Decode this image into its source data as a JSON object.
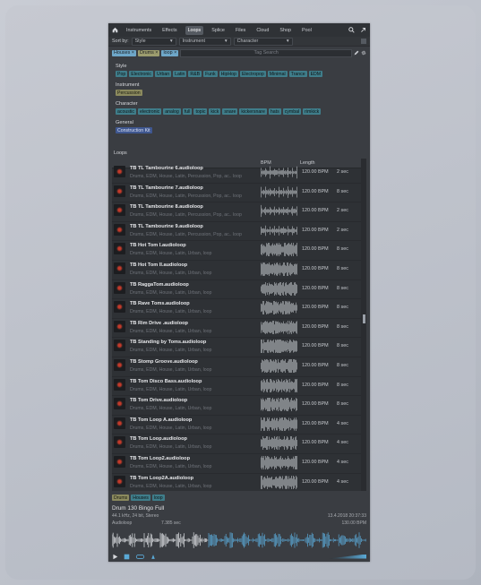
{
  "nav": {
    "tabs": [
      "Instruments",
      "Effects",
      "Loops",
      "Splice",
      "Files",
      "Cloud",
      "Shop",
      "Pool"
    ],
    "active": "Loops"
  },
  "sortbar": {
    "sort_label": "Sort by:",
    "style": "Style",
    "instrument": "Instrument",
    "character": "Character"
  },
  "filters": {
    "chips": [
      "Houses",
      "Drums",
      "loop"
    ],
    "search_placeholder": "Tag Search"
  },
  "sections": {
    "style": {
      "title": "Style",
      "tags": [
        "Pop",
        "Electronic",
        "Urban",
        "Latin",
        "R&B",
        "Funk",
        "HipHop",
        "Electropop",
        "Minimal",
        "Trance",
        "EDM"
      ]
    },
    "instrument": {
      "title": "Instrument",
      "tags": [
        "Percussion"
      ]
    },
    "character": {
      "title": "Character",
      "tags": [
        "acoustic",
        "electronic",
        "analog",
        "full",
        "topic",
        "kick",
        "snare",
        "kickersnare",
        "hats",
        "cymbal",
        "rimkick"
      ]
    },
    "general": {
      "title": "General",
      "tags": [
        "Construction Kit"
      ]
    }
  },
  "loops_label": "Loops",
  "columns": {
    "bpm": "BPM",
    "length": "Length"
  },
  "rows": [
    {
      "title": "TB TL Tambourine  6.audioloop",
      "tags": "Drums, EDM, House, Latin, Percussion, Pop, ac.. loop",
      "bpm": "120.00 BPM",
      "len": "2 sec"
    },
    {
      "title": "TB TL Tambourine  7.audioloop",
      "tags": "Drums, EDM, House, Latin, Percussion, Pop, ac.. loop",
      "bpm": "120.00 BPM",
      "len": "8 sec"
    },
    {
      "title": "TB TL Tambourine  8.audioloop",
      "tags": "Drums, EDM, House, Latin, Percussion, Pop, ac.. loop",
      "bpm": "120.00 BPM",
      "len": "2 sec"
    },
    {
      "title": "TB TL Tambourine  9.audioloop",
      "tags": "Drums, EDM, House, Latin, Percussion, Pop, ac.. loop",
      "bpm": "120.00 BPM",
      "len": "2 sec"
    },
    {
      "title": "TB Hot Tom I.audioloop",
      "tags": "Drums, EDM, House, Latin, Urban, loop",
      "bpm": "120.00 BPM",
      "len": "8 sec"
    },
    {
      "title": "TB Hot Tom II.audioloop",
      "tags": "Drums, EDM, House, Latin, Urban, loop",
      "bpm": "120.00 BPM",
      "len": "8 sec"
    },
    {
      "title": "TB RaggaTom.audioloop",
      "tags": "Drums, EDM, House, Latin, Urban, loop",
      "bpm": "120.00 BPM",
      "len": "8 sec"
    },
    {
      "title": "TB Rave Toms.audioloop",
      "tags": "Drums, EDM, House, Latin, Urban, loop",
      "bpm": "120.00 BPM",
      "len": "8 sec"
    },
    {
      "title": "TB Rim Drive .audioloop",
      "tags": "Drums, EDM, House, Latin, Urban, loop",
      "bpm": "120.00 BPM",
      "len": "8 sec"
    },
    {
      "title": "TB Standing by Toms.audioloop",
      "tags": "Drums, EDM, House, Latin, Urban, loop",
      "bpm": "120.00 BPM",
      "len": "8 sec"
    },
    {
      "title": "TB Stomp Groove.audioloop",
      "tags": "Drums, EDM, House, Latin, Urban, loop",
      "bpm": "120.00 BPM",
      "len": "8 sec"
    },
    {
      "title": "TB Tom Disco Bass.audioloop",
      "tags": "Drums, EDM, House, Latin, Urban, loop",
      "bpm": "120.00 BPM",
      "len": "8 sec"
    },
    {
      "title": "TB Tom Drive.audioloop",
      "tags": "Drums, EDM, House, Latin, Urban, loop",
      "bpm": "120.00 BPM",
      "len": "8 sec"
    },
    {
      "title": "TB Tom Loop A.audioloop",
      "tags": "Drums, EDM, House, Latin, Urban, loop",
      "bpm": "120.00 BPM",
      "len": "4 sec"
    },
    {
      "title": "TB Tom Loop.audioloop",
      "tags": "Drums, EDM, House, Latin, Urban, loop",
      "bpm": "120.00 BPM",
      "len": "4 sec"
    },
    {
      "title": "TB Tom Loop2.audioloop",
      "tags": "Drums, EDM, House, Latin, Urban, loop",
      "bpm": "120.00 BPM",
      "len": "4 sec"
    },
    {
      "title": "TB Tom Loop2A.audioloop",
      "tags": "Drums, EDM, House, Latin, Urban, loop",
      "bpm": "120.00 BPM",
      "len": "4 sec"
    }
  ],
  "bottom_tags": [
    "Drums",
    "Houses",
    "loop"
  ],
  "player": {
    "name": "Drum 130 Bingo Full",
    "format": "44.1 kHz, 24 bit, Stereo",
    "date": "13.4.2018 20:37:33",
    "type": "Audioloop",
    "duration": "7.385 sec",
    "bpm": "130.00 BPM"
  },
  "colors": {
    "accent": "#6ea7c9",
    "panel": "#3a3d42",
    "teal_tag": "#3f7d8a",
    "olive_tag": "#8b8a5e",
    "navy_tag": "#3f5790"
  }
}
